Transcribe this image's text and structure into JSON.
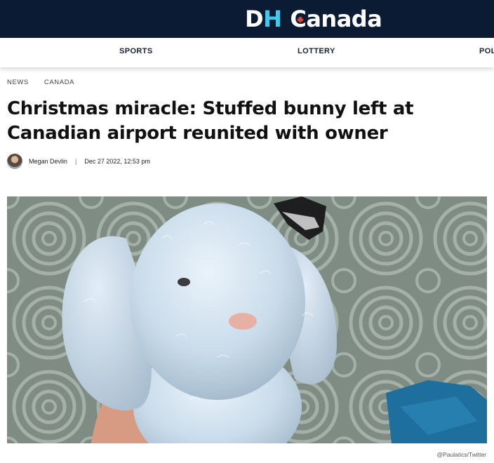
{
  "header": {
    "logo_d": "D",
    "logo_h": "H",
    "logo_canada": "Canada"
  },
  "nav": {
    "items": [
      {
        "label": "SPORTS"
      },
      {
        "label": "LOTTERY"
      },
      {
        "label": "POL"
      }
    ]
  },
  "breadcrumb": {
    "items": [
      {
        "label": "NEWS"
      },
      {
        "label": "CANADA"
      }
    ]
  },
  "article": {
    "title": "Christmas miracle: Stuffed bunny left at Canadian airport reunited with owner",
    "author": "Megan Devlin",
    "separator": "|",
    "date": "Dec 27 2022, 12:53 pm",
    "photo_credit": "@Paulatics/Twitter"
  },
  "colors": {
    "header_bg": "#0b1b33",
    "logo_accent": "#3fc9ee",
    "leaf": "#e0463c"
  }
}
